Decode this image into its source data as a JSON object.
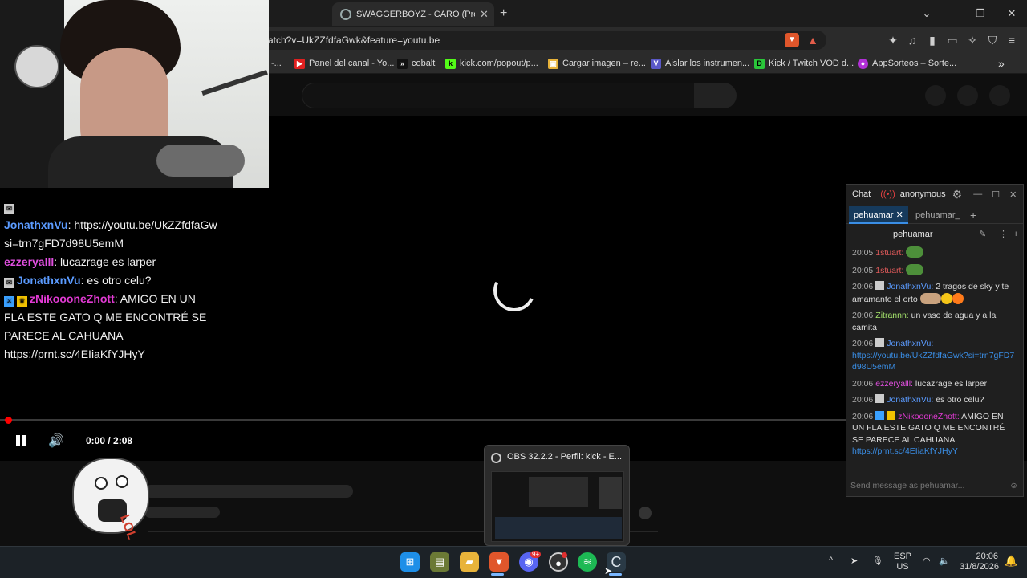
{
  "browser": {
    "tab_title": "SWAGGERBOYZ - CARO (Prod Ez",
    "new_tab": "+",
    "url": "atch?v=UkZZfdfaGwk&feature=youtu.be",
    "bookmarks": [
      {
        "label": "-..."
      },
      {
        "label": "Panel del canal - Yo..."
      },
      {
        "label": "cobalt"
      },
      {
        "label": "kick.com/popout/p..."
      },
      {
        "label": "Cargar imagen – re..."
      },
      {
        "label": "Aislar los instrumen..."
      },
      {
        "label": "Kick / Twitch VOD d..."
      },
      {
        "label": "AppSorteos – Sorte..."
      }
    ],
    "more_bookmarks": "»"
  },
  "player": {
    "time": "0:00 / 2:08",
    "progress": 0.0
  },
  "overlay_chat": [
    {
      "user": "",
      "text": ""
    },
    {
      "user": "JonathxnVu",
      "text": ": https://youtu.be/UkZZfdfaGw",
      "text2": "si=trn7gFD7d98U5emM",
      "color": "#5b9bff"
    },
    {
      "user": "ezzeryalll",
      "text": ": lucazrage es larper",
      "color": "#e14fe0"
    },
    {
      "user": "JonathxnVu",
      "text": ": es otro celu?",
      "color": "#5b9bff"
    },
    {
      "user": "zNikoooneZhott",
      "text": ": AMIGO EN UN",
      "text2": "FLA ESTE GATO Q ME ENCONTRÉ SE",
      "text3": "PARECE AL CAHUANA",
      "text4": "https://prnt.sc/4EIiaKfYJHyY",
      "color": "#e23ad4"
    }
  ],
  "meme": {
    "lol": "LOL"
  },
  "chat_window": {
    "title": "Chat",
    "user": "anonymous",
    "tabs": [
      "pehuamar",
      "pehuamar_"
    ],
    "channel": "pehuamar",
    "input_placeholder": "Send message as pehuamar...",
    "messages": [
      {
        "ts": "20:05",
        "user": "1stuart:",
        "text": "",
        "color": "#e05a5a",
        "emote": true
      },
      {
        "ts": "20:05",
        "user": "1stuart:",
        "text": "",
        "color": "#e05a5a",
        "emote": true
      },
      {
        "ts": "20:06",
        "user": "JonathxnVu:",
        "text": " 2 tragos de sky y te amamanto el orto",
        "color": "#5b9bff"
      },
      {
        "ts": "20:06",
        "user": "Zitrannn:",
        "text": " un vaso de agua y a la camita",
        "color": "#a4e26b"
      },
      {
        "ts": "20:06",
        "user": "JonathxnVu:",
        "text": "",
        "link": "https://youtu.be/UkZZfdfaGwk?si=trn7gFD7d98U5emM",
        "color": "#5b9bff"
      },
      {
        "ts": "20:06",
        "user": "ezzeryalll:",
        "text": " lucazrage es larper",
        "color": "#e14fe0"
      },
      {
        "ts": "20:06",
        "user": "JonathxnVu:",
        "text": " es otro celu?",
        "color": "#5b9bff"
      },
      {
        "ts": "20:06",
        "user": "zNikoooneZhott:",
        "text": " AMIGO EN UN FLA ESTE GATO Q ME ENCONTRÉ SE PARECE AL CAHUANA",
        "link": "https://prnt.sc/4EIiaKfYJHyY",
        "color": "#e23ad4"
      }
    ]
  },
  "thumbnail": {
    "title": "OBS 32.2.2 - Perfil: kick - E..."
  },
  "taskbar": {
    "lang1": "ESP",
    "lang2": "US",
    "time": "20:06",
    "date": "31/8/2026",
    "badge": "9+"
  }
}
